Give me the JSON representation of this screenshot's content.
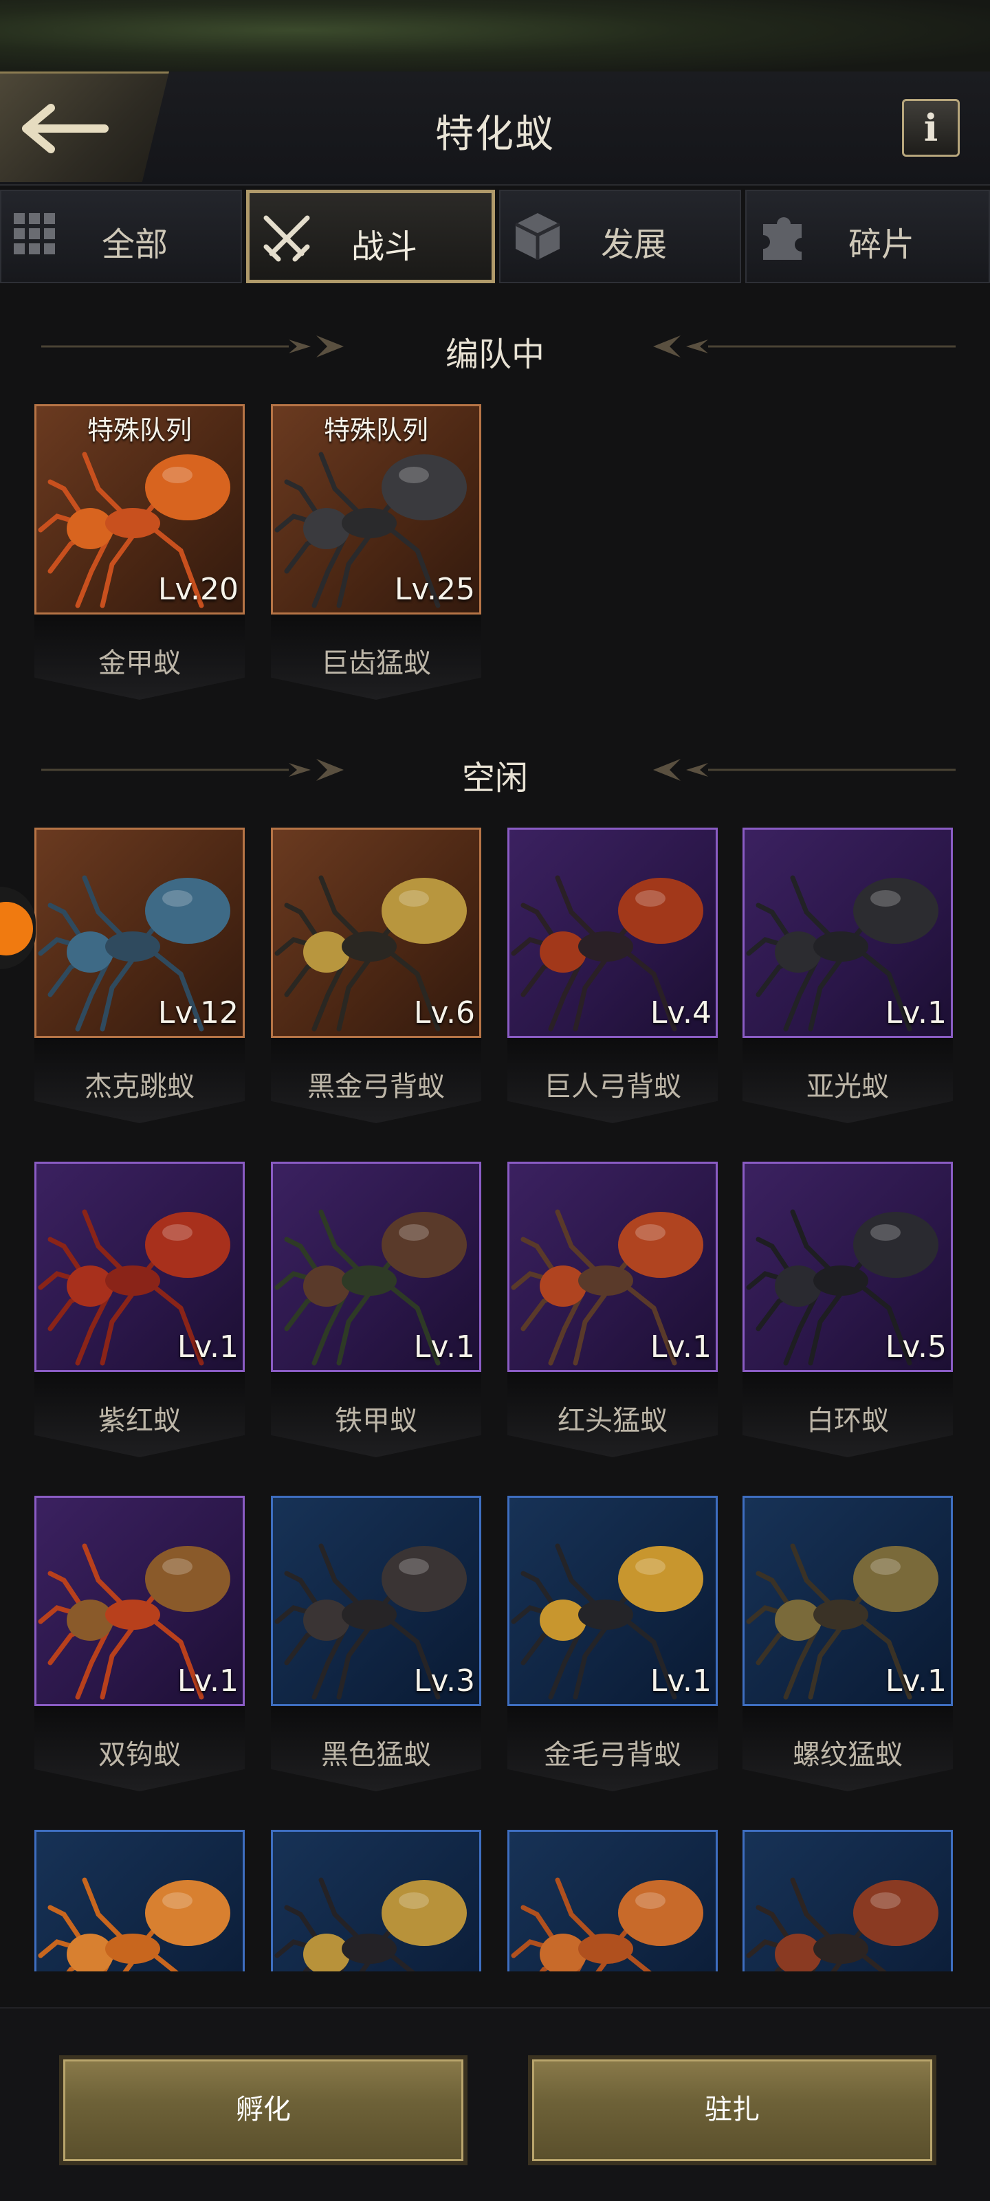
{
  "header": {
    "title": "特化蚁",
    "info_label": "i"
  },
  "tabs": [
    {
      "label": "全部",
      "icon": "grid-icon",
      "active": false
    },
    {
      "label": "战斗",
      "icon": "crossed-swords-icon",
      "active": true
    },
    {
      "label": "发展",
      "icon": "cube-icon",
      "active": false
    },
    {
      "label": "碎片",
      "icon": "puzzle-icon",
      "active": false
    }
  ],
  "sections": {
    "formation": "编队中",
    "idle": "空闲"
  },
  "formation_ants": [
    {
      "name": "金甲蚁",
      "level": "Lv.20",
      "tag": "特殊队列",
      "rarity": "orange",
      "body": "#c8501e",
      "head": "#d8641f"
    },
    {
      "name": "巨齿猛蚁",
      "level": "Lv.25",
      "tag": "特殊队列",
      "rarity": "orange",
      "body": "#2a2a2c",
      "head": "#3a3a3e"
    }
  ],
  "idle_ants": [
    {
      "name": "杰克跳蚁",
      "level": "Lv.12",
      "rarity": "orange",
      "body": "#2f4a5e",
      "head": "#3e6a86"
    },
    {
      "name": "黑金弓背蚁",
      "level": "Lv.6",
      "rarity": "orange",
      "body": "#2a2722",
      "head": "#b8963e"
    },
    {
      "name": "巨人弓背蚁",
      "level": "Lv.4",
      "rarity": "purple",
      "body": "#2a2026",
      "head": "#a2381a"
    },
    {
      "name": "亚光蚁",
      "level": "Lv.1",
      "rarity": "purple",
      "body": "#222226",
      "head": "#2c2c30"
    },
    {
      "name": "紫红蚁",
      "level": "Lv.1",
      "rarity": "purple",
      "body": "#8a2418",
      "head": "#a8301c"
    },
    {
      "name": "铁甲蚁",
      "level": "Lv.1",
      "rarity": "purple",
      "body": "#2e3a26",
      "head": "#5a3a2a"
    },
    {
      "name": "红头猛蚁",
      "level": "Lv.1",
      "rarity": "purple",
      "body": "#5a3a2a",
      "head": "#b04420"
    },
    {
      "name": "白环蚁",
      "level": "Lv.5",
      "rarity": "purple",
      "body": "#1e1e22",
      "head": "#2a2a30"
    },
    {
      "name": "双钩蚁",
      "level": "Lv.1",
      "rarity": "purple",
      "body": "#b8401c",
      "head": "#8a5a2a"
    },
    {
      "name": "黑色猛蚁",
      "level": "Lv.3",
      "rarity": "blue",
      "body": "#262426",
      "head": "#3a3434"
    },
    {
      "name": "金毛弓背蚁",
      "level": "Lv.1",
      "rarity": "blue",
      "body": "#242428",
      "head": "#c8962e"
    },
    {
      "name": "螺纹猛蚁",
      "level": "Lv.1",
      "rarity": "blue",
      "body": "#3a3226",
      "head": "#7a6a3a"
    },
    {
      "name": "",
      "level": "",
      "rarity": "blue",
      "body": "#c8661e",
      "head": "#d88030"
    },
    {
      "name": "",
      "level": "",
      "rarity": "blue",
      "body": "#242226",
      "head": "#b8923a"
    },
    {
      "name": "",
      "level": "",
      "rarity": "blue",
      "body": "#b0501e",
      "head": "#c86a2a"
    },
    {
      "name": "",
      "level": "",
      "rarity": "blue",
      "body": "#2c2422",
      "head": "#8a3a22"
    }
  ],
  "actions": {
    "hatch": "孵化",
    "garrison": "驻扎"
  }
}
